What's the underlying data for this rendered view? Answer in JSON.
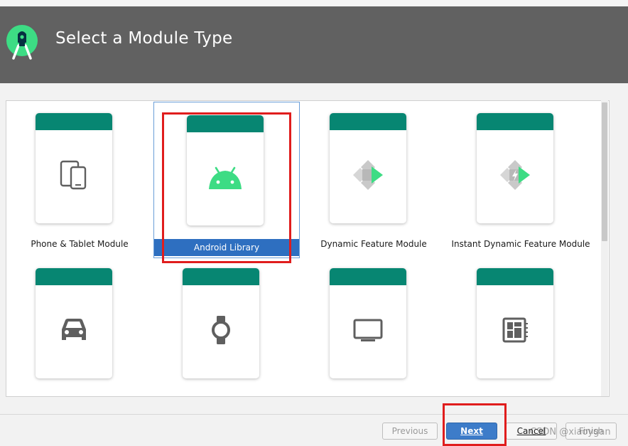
{
  "header": {
    "title": "Select a Module Type",
    "logo_icon": "android-studio-logo-icon"
  },
  "colors": {
    "header_bg": "#616161",
    "card_band": "#078672",
    "android_green": "#3ddc84",
    "selection_blue": "#2e6fc0",
    "highlight_red": "#e01d1d"
  },
  "modules": [
    {
      "label": "Phone & Tablet Module",
      "icon": "phone-tablet-icon"
    },
    {
      "label": "Android Library",
      "icon": "android-robot-icon",
      "selected": true
    },
    {
      "label": "Dynamic Feature Module",
      "icon": "dynamic-feature-icon"
    },
    {
      "label": "Instant Dynamic Feature Module",
      "icon": "instant-dynamic-feature-icon"
    },
    {
      "label": "",
      "icon": "car-icon"
    },
    {
      "label": "",
      "icon": "watch-icon"
    },
    {
      "label": "",
      "icon": "tv-icon"
    },
    {
      "label": "",
      "icon": "things-board-icon"
    }
  ],
  "footer": {
    "previous_label": "Previous",
    "next_label": "Next",
    "cancel_label": "Cancel",
    "finish_label": "Finish"
  },
  "watermark": "CSDN @xiaoygan"
}
